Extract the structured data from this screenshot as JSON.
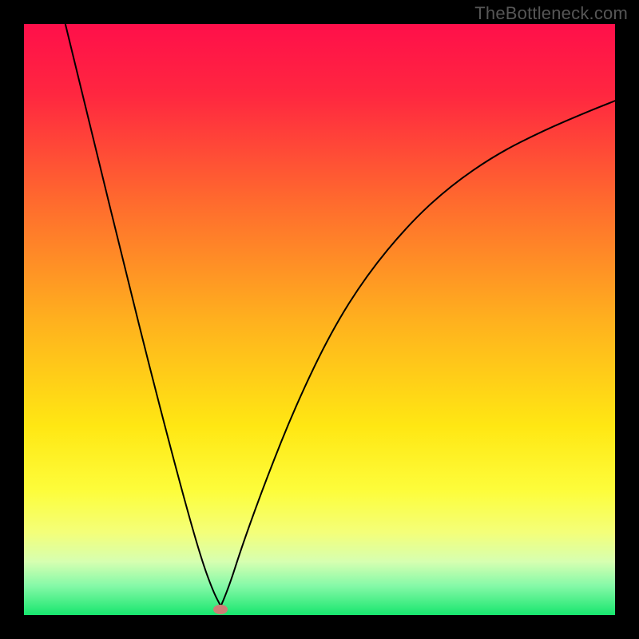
{
  "watermark": "TheBottleneck.com",
  "chart_data": {
    "type": "line",
    "x_range": [
      0,
      100
    ],
    "y_range": [
      0,
      100
    ],
    "xlabel": "",
    "ylabel": "",
    "title": "",
    "note": "Values are in percent of plot dimensions; y=0 at bottom, y=100 at top.",
    "gradient_stops": [
      {
        "offset": 0,
        "color": "#ff0f4a"
      },
      {
        "offset": 12,
        "color": "#ff2740"
      },
      {
        "offset": 30,
        "color": "#ff6a2e"
      },
      {
        "offset": 50,
        "color": "#ffb01e"
      },
      {
        "offset": 68,
        "color": "#ffe713"
      },
      {
        "offset": 79,
        "color": "#fdfd3b"
      },
      {
        "offset": 86,
        "color": "#f4ff79"
      },
      {
        "offset": 91,
        "color": "#d6ffb1"
      },
      {
        "offset": 95,
        "color": "#86f9a8"
      },
      {
        "offset": 100,
        "color": "#17e66e"
      }
    ],
    "series": [
      {
        "name": "left-branch",
        "points": [
          {
            "x": 7.0,
            "y": 100.0
          },
          {
            "x": 12.0,
            "y": 79.5
          },
          {
            "x": 17.0,
            "y": 59.0
          },
          {
            "x": 22.0,
            "y": 39.0
          },
          {
            "x": 27.0,
            "y": 20.0
          },
          {
            "x": 30.0,
            "y": 9.5
          },
          {
            "x": 32.0,
            "y": 4.0
          },
          {
            "x": 33.3,
            "y": 1.5
          }
        ]
      },
      {
        "name": "right-branch",
        "points": [
          {
            "x": 33.3,
            "y": 1.5
          },
          {
            "x": 34.5,
            "y": 4.2
          },
          {
            "x": 37.0,
            "y": 12.0
          },
          {
            "x": 41.0,
            "y": 23.0
          },
          {
            "x": 46.0,
            "y": 35.5
          },
          {
            "x": 52.0,
            "y": 48.0
          },
          {
            "x": 58.0,
            "y": 57.5
          },
          {
            "x": 65.0,
            "y": 66.0
          },
          {
            "x": 72.0,
            "y": 72.5
          },
          {
            "x": 80.0,
            "y": 78.0
          },
          {
            "x": 88.0,
            "y": 82.0
          },
          {
            "x": 95.0,
            "y": 85.0
          },
          {
            "x": 100.0,
            "y": 87.0
          }
        ]
      }
    ],
    "marker": {
      "x": 33.2,
      "y": 1.0,
      "color": "#cf7d76"
    },
    "curve_color": "#000000",
    "curve_width": 2.0
  }
}
